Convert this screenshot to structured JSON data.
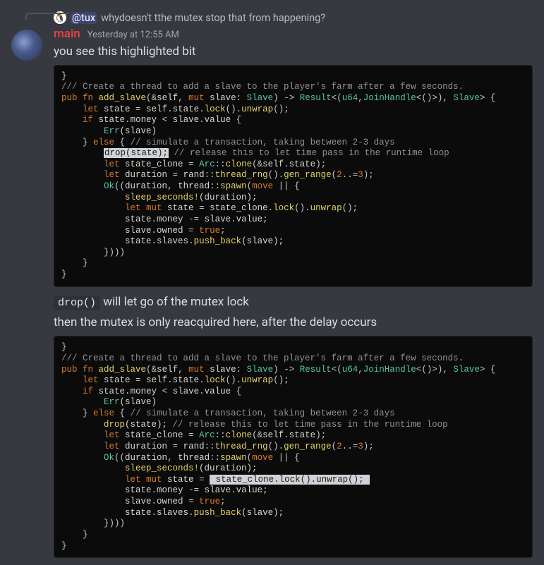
{
  "reply": {
    "avatar_emoji": "🐧",
    "mention": "@tux",
    "text": "whydoesn't tthe mutex stop that from happening?"
  },
  "message": {
    "author": "main",
    "timestamp": "Yesterday at 12:55 AM",
    "line1": "you see this highlighted bit",
    "inline_code": "drop()",
    "after_inline": " will let go of the mutex lock",
    "line3": "then the mutex is only reacquired here, after the delay occurs"
  },
  "code": {
    "brace_close": "}",
    "c1": "/// Create a thread to add a slave to the player's farm after a few seconds.",
    "sig_pub": "pub ",
    "sig_fn": "fn ",
    "sig_name": "add_slave",
    "sig_p_open": "(",
    "sig_amp_self": "&",
    "sig_self": "self",
    "sig_comma1": ", ",
    "sig_mut": "mut ",
    "sig_slave": "slave",
    "sig_colon1": ": ",
    "sig_Slave": "Slave",
    "sig_p_close": ") ",
    "sig_arrow": "-> ",
    "sig_Result": "Result",
    "sig_lt": "<",
    "sig_tuple_open": "(",
    "sig_u64": "u64",
    "sig_comma2": ",",
    "sig_JoinHandle": "JoinHandle",
    "sig_lt2": "<",
    "sig_unit": "()",
    "sig_gt2": ">",
    "sig_tuple_close": ")",
    "sig_comma3": ", ",
    "sig_Slave2": "Slave",
    "sig_gt": "> ",
    "sig_brace": "{",
    "l3_let": "let ",
    "l3_state": "state ",
    "l3_eq": "= ",
    "l3_self": "self",
    "l3_dot1": ".",
    "l3_field": "state",
    "l3_dot2": ".",
    "l3_lock": "lock",
    "l3_par1": "()",
    "l3_dot3": ".",
    "l3_unwrap": "unwrap",
    "l3_par2": "();",
    "l4_if": "if ",
    "l4_state": "state",
    "l4_dot": ".",
    "l4_money": "money ",
    "l4_lt": "< ",
    "l4_slave": "slave",
    "l4_dot2": ".",
    "l4_value": "value ",
    "l4_brace": "{",
    "l5_Err": "Err",
    "l5_par": "(slave)",
    "l6_close": "} ",
    "l6_else": "else ",
    "l6_brace": "{ ",
    "l6_comment": "// simulate a transaction, taking between 2-3 days",
    "l7_drop": "drop",
    "l7_par": "(state); ",
    "l7_comment": "// release this to let time pass in the runtime loop",
    "hl_drop": "drop(state);",
    "hl_space": " ",
    "l8_let": "let ",
    "l8_sc": "state_clone ",
    "l8_eq": "= ",
    "l8_Arc": "Arc",
    "l8_cc": "::",
    "l8_clone": "clone",
    "l8_open": "(",
    "l8_amp": "&",
    "l8_self": "self",
    "l8_dot": ".",
    "l8_state": "state",
    "l8_close": ");",
    "l9_let": "let ",
    "l9_dur": "duration ",
    "l9_eq": "= ",
    "l9_rand": "rand",
    "l9_cc": "::",
    "l9_rng": "thread_rng",
    "l9_par1": "()",
    "l9_dot": ".",
    "l9_gen": "gen_range",
    "l9_open": "(",
    "l9_two": "2",
    "l9_range": "..=",
    "l9_three": "3",
    "l9_close": ");",
    "l10_Ok": "Ok",
    "l10_open": "((",
    "l10_dur": "duration",
    "l10_comma": ", ",
    "l10_thread": "thread",
    "l10_cc": "::",
    "l10_spawn": "spawn",
    "l10_paren": "(",
    "l10_move": "move ",
    "l10_bars": "|| {",
    "l11_sleep": "sleep_seconds!",
    "l11_par": "(duration);",
    "l12_let": "let ",
    "l12_mut": "mut ",
    "l12_state": "state ",
    "l12_eq": "= ",
    "l12_sc": "state_clone",
    "l12_dot1": ".",
    "l12_lock": "lock",
    "l12_par1": "()",
    "l12_dot2": ".",
    "l12_unwrap": "unwrap",
    "l12_par2": "();",
    "hl2_start": " state_clone.lock().unwrap(); ",
    "l13_state": "state",
    "l13_dot": ".",
    "l13_money": "money ",
    "l13_minus": "-= ",
    "l13_slave": "slave",
    "l13_dot2": ".",
    "l13_value": "value;",
    "l14_slave": "slave",
    "l14_dot": ".",
    "l14_owned": "owned ",
    "l14_eq": "= ",
    "l14_true": "true",
    "l14_semi": ";",
    "l15_state": "state",
    "l15_dot": ".",
    "l15_slaves": "slaves",
    "l15_dot2": ".",
    "l15_push": "push_back",
    "l15_par": "(slave);",
    "l16_close": "})))",
    "l17_close": "}"
  }
}
